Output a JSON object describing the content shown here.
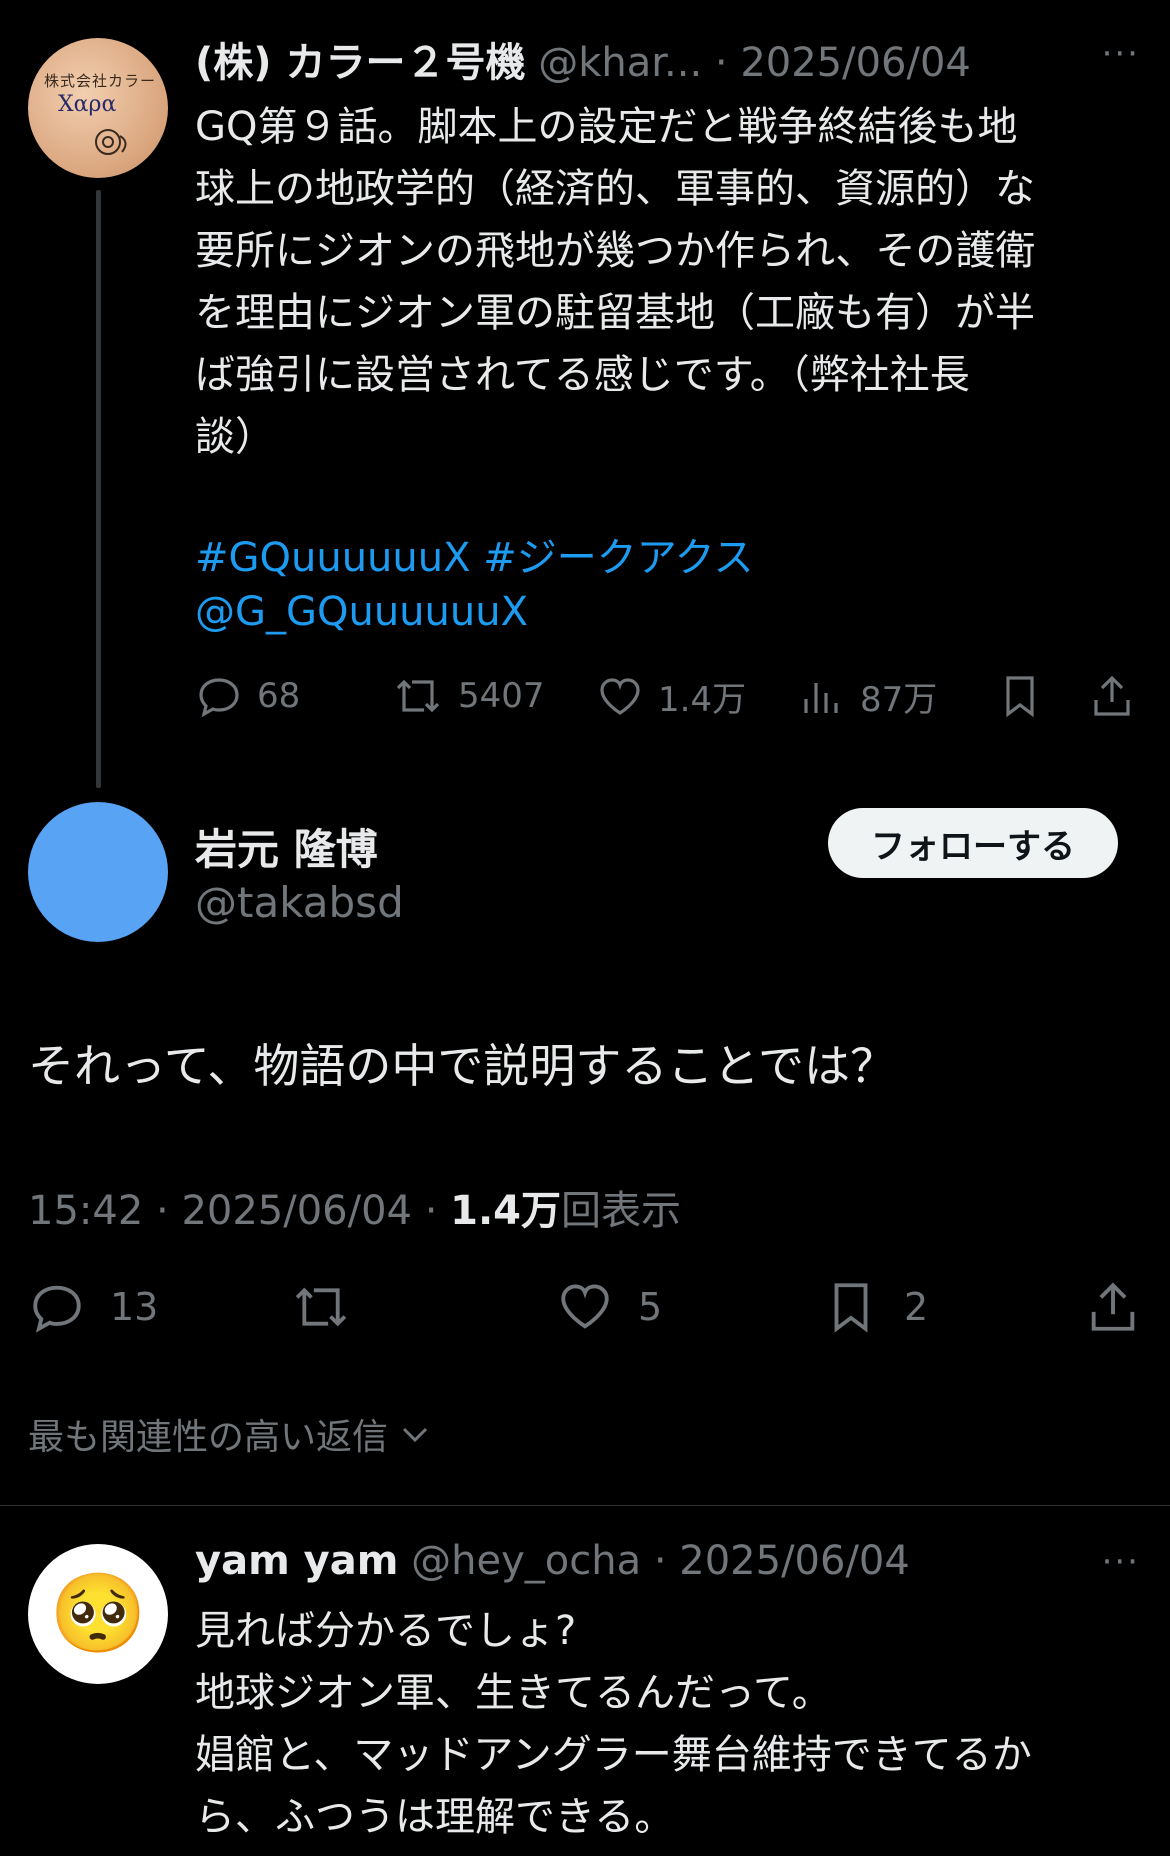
{
  "tweet1": {
    "display_name": "(株) カラー２号機",
    "handle": "@khar...",
    "separator": " · ",
    "date": "2025/06/04",
    "more": "···",
    "avatar_text_line1": "株式会社カラー",
    "avatar_text_line2": "Χαρα",
    "body": "GQ第９話。脚本上の設定だと戦争終結後も地\n球上の地政学的（経済的、軍事的、資源的）な\n要所にジオンの飛地が幾つか作られ、その護衛\nを理由にジオン軍の駐留基地（工廠も有）が半\nば強引に設営されてる感じです。（弊社社長\n談）",
    "hashtags": "#GQuuuuuuX #ジークアクス",
    "mention": "@G_GQuuuuuuX",
    "stats": {
      "replies": "68",
      "reposts": "5407",
      "likes": "1.4万",
      "views": "87万"
    }
  },
  "main_tweet": {
    "display_name": "岩元 隆博",
    "handle": "@takabsd",
    "follow_label": "フォローする",
    "text": "それって、物語の中で説明することでは？",
    "time": "15:42",
    "date": "2025/06/04",
    "views_count": "1.4万",
    "views_label": "回表示",
    "stats": {
      "replies": "13",
      "likes": "5",
      "bookmarks": "2"
    }
  },
  "sort_label": "最も関連性の高い返信",
  "reply": {
    "display_name": "yam yam",
    "handle": "@hey_ocha",
    "date": "2025/06/04",
    "avatar_emoji": "🥺",
    "body": "見れば分かるでしょ?\n地球ジオン軍、生きてるんだって。\n娼館と、マッドアングラー舞台維持できてるか\nら、ふつうは理解できる。"
  }
}
